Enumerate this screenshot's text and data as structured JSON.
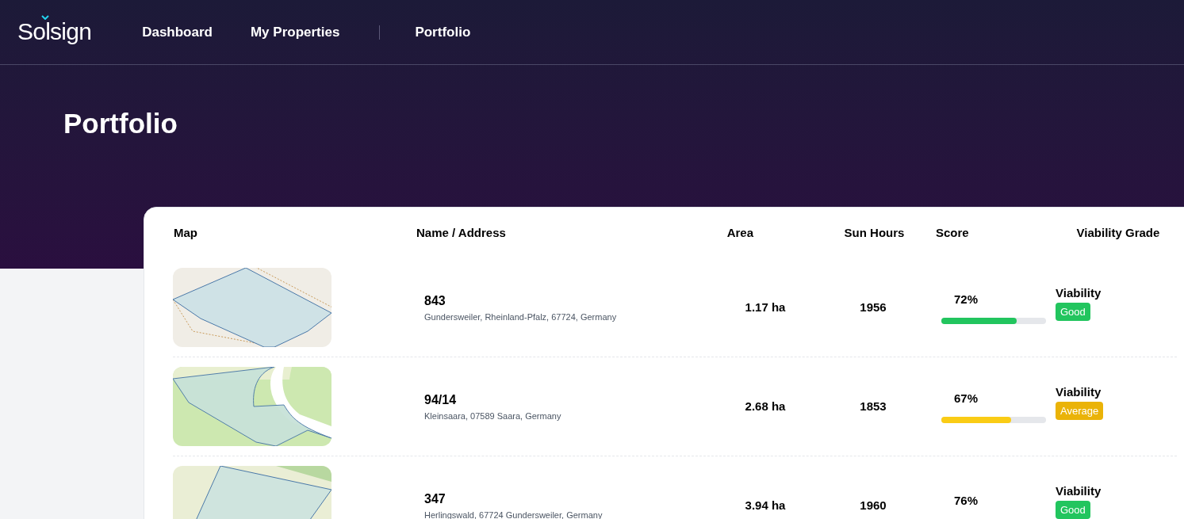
{
  "nav": {
    "logo": "Solsign",
    "links": [
      {
        "label": "Dashboard"
      },
      {
        "label": "My Properties"
      },
      {
        "label": "Portfolio"
      }
    ]
  },
  "page_title": "Portfolio",
  "table": {
    "columns": [
      "Map",
      "Name / Address",
      "Area",
      "Sun Hours",
      "Score",
      "Viability Grade"
    ],
    "rows": [
      {
        "name": "843",
        "address": "Gundersweiler, Rheinland-Pfalz, 67724, Germany",
        "area": "1.17 ha",
        "sun_hours": "1956",
        "score": {
          "text": "72%",
          "level": 0.72,
          "color": "#22c55e"
        },
        "grade": {
          "label": "Viability",
          "badge": "Good",
          "color": "#22c55e"
        }
      },
      {
        "name": "94/14",
        "address": "Kleinsaara, 07589 Saara, Germany",
        "area": "2.68 ha",
        "sun_hours": "1853",
        "score": {
          "text": "67%",
          "level": 0.67,
          "color": "#facc15"
        },
        "grade": {
          "label": "Viability",
          "badge": "Average",
          "color": "#eab308"
        }
      },
      {
        "name": "347",
        "address": "Herlingswald, 67724 Gundersweiler, Germany",
        "area": "3.94 ha",
        "sun_hours": "1960",
        "score": {
          "text": "76%"
        },
        "grade": {
          "label": "Viability",
          "badge": "Good",
          "color": "#22c55e"
        }
      }
    ]
  }
}
